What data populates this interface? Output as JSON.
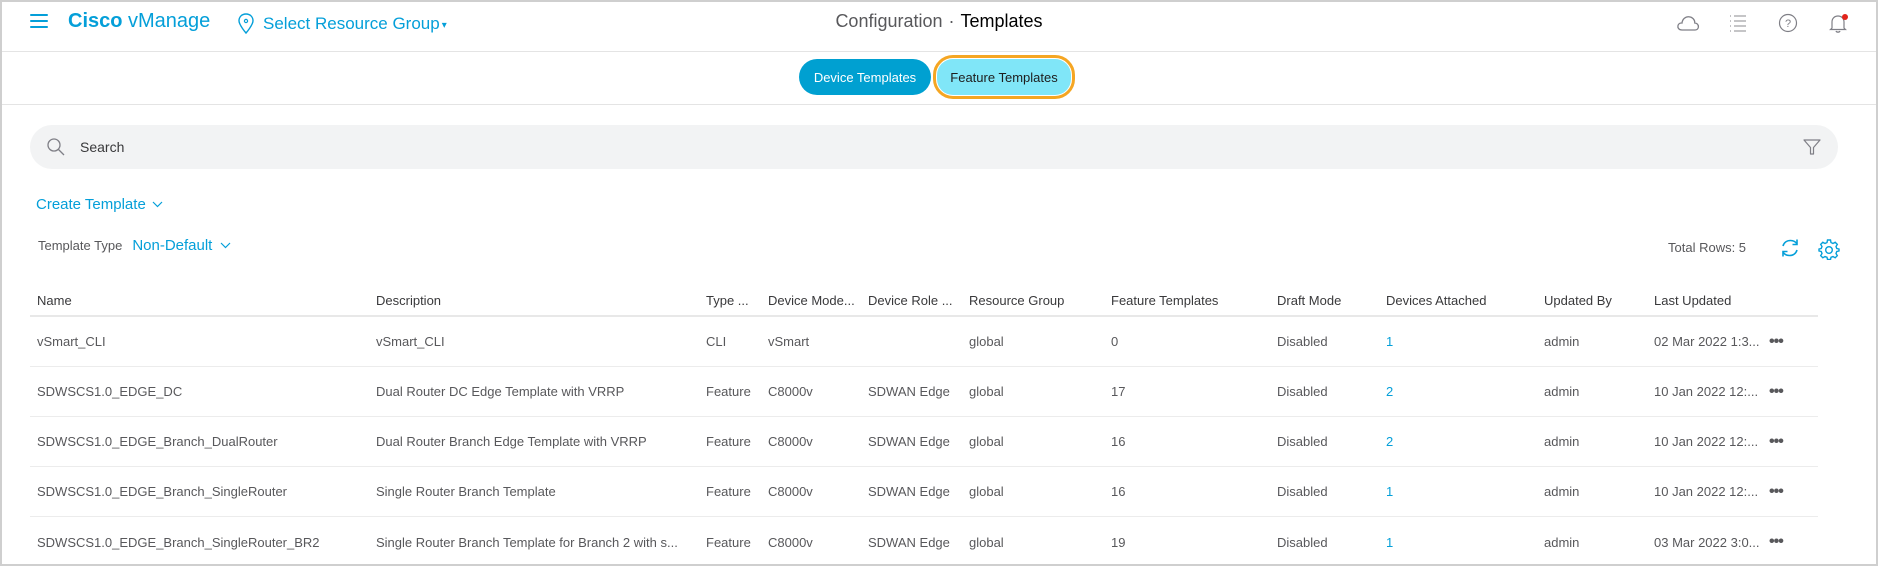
{
  "header": {
    "brand_bold": "Cisco",
    "brand_rest": " vManage",
    "resource_group_label": "Select Resource Group",
    "resource_group_caret": "▾",
    "breadcrumb_parent": "Configuration",
    "breadcrumb_separator": "·",
    "breadcrumb_current": "Templates",
    "icons": [
      "cloud-icon",
      "task-list-icon",
      "help-icon",
      "notification-bell-icon"
    ]
  },
  "tabs": [
    {
      "label": "Device Templates",
      "active": false
    },
    {
      "label": "Feature Templates",
      "active": true
    }
  ],
  "search": {
    "placeholder": "Search",
    "value": ""
  },
  "toolbar": {
    "create_template_label": "Create Template",
    "template_type_label": "Template Type",
    "template_type_value": "Non-Default",
    "total_rows_label": "Total Rows: 5"
  },
  "table": {
    "columns": [
      "Name",
      "Description",
      "Type ...",
      "Device Mode...",
      "Device Role ...",
      "Resource Group",
      "Feature Templates",
      "Draft Mode",
      "Devices Attached",
      "Updated By",
      "Last Updated"
    ],
    "rows": [
      {
        "name": "vSmart_CLI",
        "description": "vSmart_CLI",
        "type": "CLI",
        "device_model": "vSmart",
        "device_role": "",
        "resource_group": "global",
        "feature_templates": "0",
        "draft_mode": "Disabled",
        "devices_attached": "1",
        "updated_by": "admin",
        "last_updated": "02 Mar 2022 1:3..."
      },
      {
        "name": "SDWSCS1.0_EDGE_DC",
        "description": "Dual Router DC Edge Template with VRRP",
        "type": "Feature",
        "device_model": "C8000v",
        "device_role": "SDWAN Edge",
        "resource_group": "global",
        "feature_templates": "17",
        "draft_mode": "Disabled",
        "devices_attached": "2",
        "updated_by": "admin",
        "last_updated": "10 Jan 2022 12:..."
      },
      {
        "name": "SDWSCS1.0_EDGE_Branch_DualRouter",
        "description": "Dual Router Branch Edge Template with VRRP",
        "type": "Feature",
        "device_model": "C8000v",
        "device_role": "SDWAN Edge",
        "resource_group": "global",
        "feature_templates": "16",
        "draft_mode": "Disabled",
        "devices_attached": "2",
        "updated_by": "admin",
        "last_updated": "10 Jan 2022 12:..."
      },
      {
        "name": "SDWSCS1.0_EDGE_Branch_SingleRouter",
        "description": "Single Router Branch Template",
        "type": "Feature",
        "device_model": "C8000v",
        "device_role": "SDWAN Edge",
        "resource_group": "global",
        "feature_templates": "16",
        "draft_mode": "Disabled",
        "devices_attached": "1",
        "updated_by": "admin",
        "last_updated": "10 Jan 2022 12:..."
      },
      {
        "name": "SDWSCS1.0_EDGE_Branch_SingleRouter_BR2",
        "description": "Single Router Branch Template for Branch 2 with s...",
        "type": "Feature",
        "device_model": "C8000v",
        "device_role": "SDWAN Edge",
        "resource_group": "global",
        "feature_templates": "19",
        "draft_mode": "Disabled",
        "devices_attached": "1",
        "updated_by": "admin",
        "last_updated": "03 Mar 2022 3:0..."
      }
    ],
    "row_action": "•••"
  },
  "colors": {
    "accent": "#049fd9",
    "active_tab_bg": "#80e6f8",
    "device_tab_bg": "#00a0d1",
    "highlight_outline": "#f5a623",
    "notification_dot": "#e2231a"
  }
}
